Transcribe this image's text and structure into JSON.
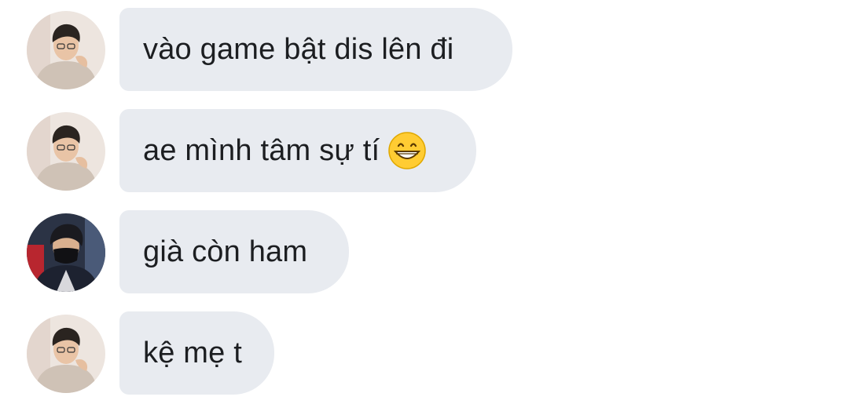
{
  "messages": [
    {
      "text": "vào game bật dis lên đi",
      "avatar": "user-a-avatar",
      "emoji": ""
    },
    {
      "text": "ae mình tâm sự tí",
      "avatar": "user-a-avatar",
      "emoji": "grinning-face-icon"
    },
    {
      "text": "già còn ham",
      "avatar": "user-b-avatar",
      "emoji": ""
    },
    {
      "text": "kệ mẹ t",
      "avatar": "user-a-avatar",
      "emoji": ""
    }
  ],
  "colors": {
    "bubble": "#e8ebf0",
    "text": "#1c1e21",
    "background": "#ffffff"
  }
}
